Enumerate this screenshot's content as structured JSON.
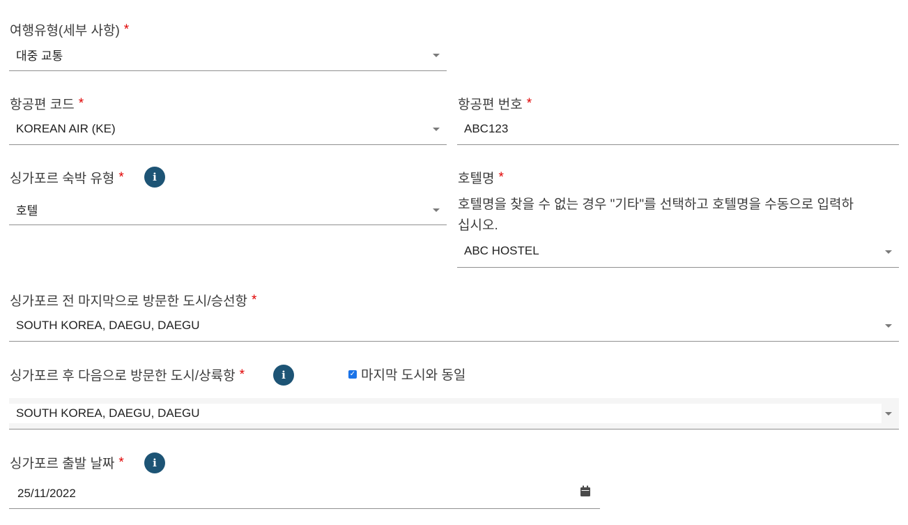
{
  "required_mark": "*",
  "travel_type": {
    "label": "여행유형(세부 사항)",
    "value": "대중 교통"
  },
  "flight_code": {
    "label": "항공편 코드",
    "value": "KOREAN AIR (KE)"
  },
  "flight_number": {
    "label": "항공편 번호",
    "value": "ABC123"
  },
  "accommodation_type": {
    "label": "싱가포르 숙박 유형",
    "value": "호텔",
    "info_icon": "i"
  },
  "hotel_name": {
    "label": "호텔명",
    "helper_line1": "호텔명을 찾을 수 없는 경우 \"기타\"를 선택하고 호텔명을 수동으로 입력하",
    "helper_line2": "십시오.",
    "value": "ABC HOSTEL"
  },
  "last_city": {
    "label": "싱가포르 전 마지막으로 방문한 도시/승선항",
    "value": "SOUTH KOREA, DAEGU, DAEGU"
  },
  "next_city": {
    "label": "싱가포르 후 다음으로 방문한 도시/상륙항",
    "info_icon": "i",
    "same_as_last_checkbox": {
      "label": "마지막 도시와 동일",
      "checked": true
    },
    "value": "SOUTH KOREA, DAEGU, DAEGU"
  },
  "departure_date": {
    "label": "싱가포르 출발 날짜",
    "value": "25/11/2022",
    "info_icon": "i"
  },
  "colors": {
    "accent": "#1d5475",
    "required": "#e00000",
    "checkbox": "#1a73e8",
    "disabled_bg": "#f5f5f5"
  }
}
